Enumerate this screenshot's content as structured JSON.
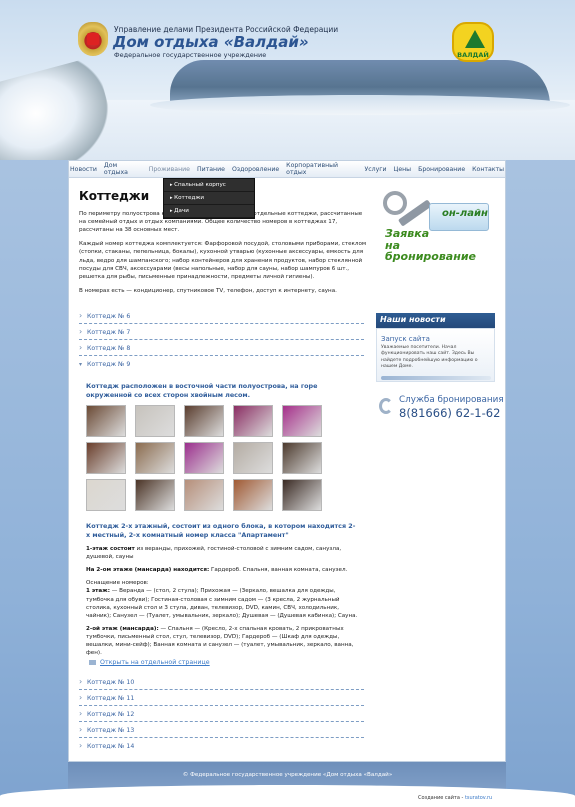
{
  "header": {
    "org_line": "Управление делами Президента Российской Федерации",
    "title": "Дом отдыха «Валдай»",
    "subtitle": "Федеральное государственное учреждение",
    "logo_text": "ВАЛДАЙ"
  },
  "nav": {
    "items": [
      "Новости",
      "Дом отдыха",
      "Проживание",
      "Питание",
      "Оздоровление",
      "Корпоративный отдых",
      "Услуги",
      "Цены",
      "Бронирование",
      "Контакты"
    ],
    "active": "Проживание",
    "dropdown": [
      "Спальный корпус",
      "Коттеджи",
      "Дачи"
    ]
  },
  "main": {
    "title": "Коттеджи",
    "intro": [
      "По периметру полуострова на берегу озера расположены отдельные коттеджи, рассчитанные на семейный отдых и отдых компаниями. Общее количество номеров в коттеджах 17, рассчитаны на 38 основных мест.",
      "Каждый номер коттеджа комплектуется: Фарфоровой посудой, столовыми приборами, стеклом (стопки, стаканы, пепельница, бокалы), кухонной утварью (кухонные аксессуары, емкость для льда, ведро для шампанского; набор контейнеров для хранения продуктов, набор стеклянной посуды для СВЧ, аксессуарами (весы напольные, набор для сауны, набор шампуров 6 шт., решетка для рыбы, письменные принадлежности, предметы личной гигиены).",
      "В номерах есть — кондиционер, спутниковое TV, телефон, доступ к интернету, сауна."
    ],
    "accordion_top": [
      "Коттедж № 6",
      "Коттедж № 7",
      "Коттедж № 8",
      "Коттедж № 9"
    ],
    "cottage9": {
      "heading1": "Коттедж расположен в восточной части полуострова, на горе окруженной со всех сторон хвойным лесом.",
      "heading2": "Коттедж 2-х этажный, состоит из одного блока, в котором находится 2-х местный, 2-х комнатный номер класса \"Апартамент\"",
      "p1_label": "1-этаж состоит",
      "p1_text": " из веранды, прихожей, гостиной-столовой с зимним садом,  санузла, душевой, сауны",
      "p2_label": "На 2-ом этаже (мансарда) находится:",
      "p2_text": " Гардероб.  Спальня, ванная комната, санузел.",
      "p3_title": "Оснащение номеров:",
      "p3_label": "1 этаж:",
      "p3_text": " — Веранда — (стол, 2 стула); Прихожая — (Зеркало, вешалка для одежды, тумбочка для обуви); Гостиная-столовая с зимним садом — (3 кресла, 2 журнальный столика, кухонный стол и 3 стула, диван, телевизор, DVD, камин, СВЧ, холодильник, чайник); Санузел — (Туалет, умывальник, зеркало); Душевая — (Душевая кабинка); Сауна.",
      "p4_label": "2-ой этаж (мансарда):",
      "p4_text": " — Спальня — (Кресло, 2-х спальная кровать, 2 прикроватных тумбочки, письменный стол, стул, телевизор, DVD);  Гардероб — (Шкаф для одежды, вешалки, мини-сейф); Ванная комната и санузел — (туалет, умывальник, зеркало, ванна, фен).",
      "open_link": "Открыть на отдельной странице"
    },
    "accordion_bottom": [
      "Коттедж № 10",
      "Коттедж № 11",
      "Коттедж № 12",
      "Коттедж № 13",
      "Коттедж № 14"
    ]
  },
  "sidebar": {
    "online": "он-лайн",
    "request": "Заявка\nна бронирование",
    "news_title": "Наши новости",
    "news_head": "Запуск сайта",
    "news_text": "Уважаемые посетители. Начал функционировать наш сайт. Здесь Вы найдете подробнейшую информацию о нашем Доме.",
    "service": "Служба бронирования",
    "phone": "8(81666) 62-1-62"
  },
  "footer": {
    "copyright": "© Федеральное государственное учреждение «Дом отдыха «Валдай»",
    "made_by": "Создание сайта - ",
    "made_link": "tsuratov.ru"
  },
  "colors": {
    "accent": "#3b65a3",
    "title_blue": "#2c5592",
    "green": "#3c8b1f",
    "dropdown_bg": "#2f2f2f"
  },
  "gallery_colors": [
    "#6b4a35",
    "#c7c3bd",
    "#5a3d2e",
    "#8a2d63",
    "#a52f8a",
    "#6a3e2b",
    "#8b6c4f",
    "#9b2f8d",
    "#b4aca3",
    "#4c3a2d",
    "#dcd7cf",
    "#4b3426",
    "#b68f7a",
    "#a05a33",
    "#3a2a23"
  ]
}
